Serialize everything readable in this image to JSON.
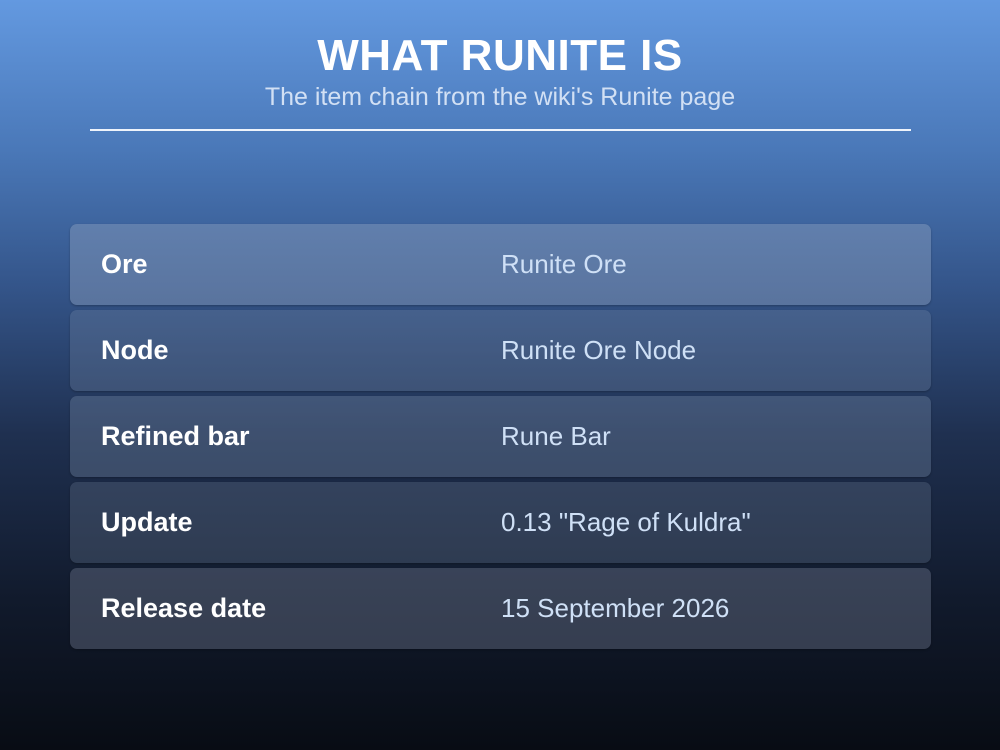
{
  "header": {
    "title": "WHAT RUNITE IS",
    "subtitle": "The item chain from the wiki's Runite page"
  },
  "rows": [
    {
      "label": "Ore",
      "value": "Runite Ore"
    },
    {
      "label": "Node",
      "value": "Runite Ore Node"
    },
    {
      "label": "Refined bar",
      "value": "Rune Bar"
    },
    {
      "label": "Update",
      "value": "0.13 \"Rage of Kuldra\""
    },
    {
      "label": "Release date",
      "value": "15 September 2026"
    }
  ]
}
